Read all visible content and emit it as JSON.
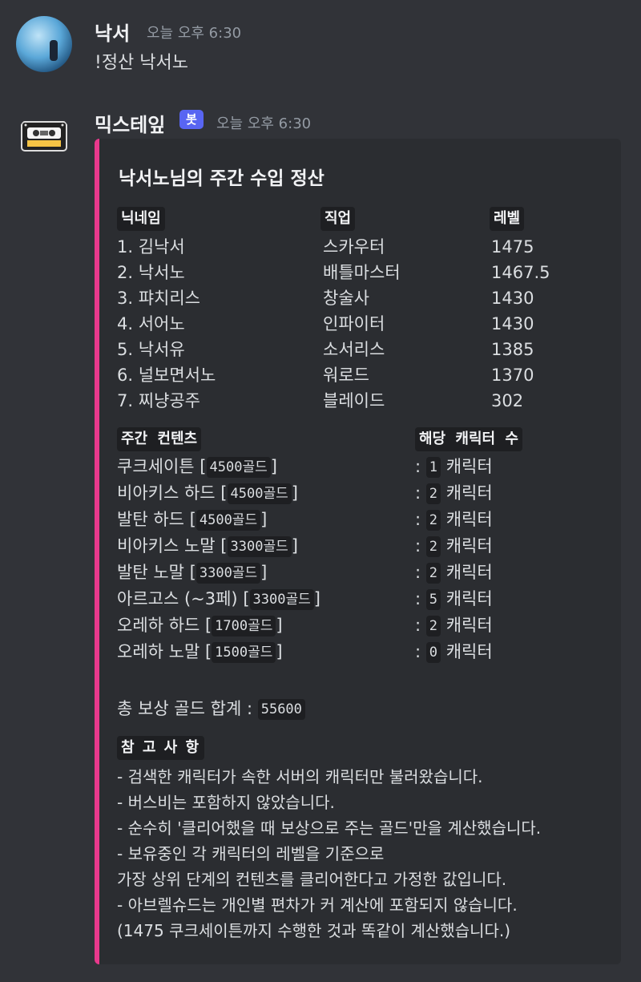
{
  "messages": [
    {
      "username": "낙서",
      "timestamp": "오늘 오후 6:30",
      "content": "!정산 낙서노"
    },
    {
      "username": "믹스테잎",
      "badge": "봇",
      "timestamp": "오늘 오후 6:30"
    }
  ],
  "embed": {
    "accent_color": "#e8398c",
    "title": "낙서노님의 주간 수입 정산",
    "characters_headers": {
      "nickname": "닉네임",
      "job": "직업",
      "level": "레벨"
    },
    "characters": [
      {
        "name": "1. 김낙서",
        "job": "스카우터",
        "level": "1475"
      },
      {
        "name": "2. 낙서노",
        "job": "배틀마스터",
        "level": "1467.5"
      },
      {
        "name": "3. 퍄치리스",
        "job": "창술사",
        "level": "1430"
      },
      {
        "name": "4. 서어노",
        "job": "인파이터",
        "level": "1430"
      },
      {
        "name": "5. 낙서유",
        "job": "소서리스",
        "level": "1385"
      },
      {
        "name": "6. 널보면서노",
        "job": "워로드",
        "level": "1370"
      },
      {
        "name": "7. 찌냥공주",
        "job": "블레이드",
        "level": "302"
      }
    ],
    "content_headers": {
      "content": "주간 컨텐츠",
      "count": "해당 캐릭터 수"
    },
    "contents": [
      {
        "name": "쿠크세이튼",
        "gold": "4500골드",
        "count": "1",
        "unit": "캐릭터"
      },
      {
        "name": "비아키스 하드",
        "gold": "4500골드",
        "count": "2",
        "unit": "캐릭터"
      },
      {
        "name": "발탄 하드",
        "gold": "4500골드",
        "count": "2",
        "unit": "캐릭터"
      },
      {
        "name": "비아키스 노말",
        "gold": "3300골드",
        "count": "2",
        "unit": "캐릭터"
      },
      {
        "name": "발탄 노말",
        "gold": "3300골드",
        "count": "2",
        "unit": "캐릭터"
      },
      {
        "name": "아르고스 (~3페)",
        "gold": "3300골드",
        "count": "5",
        "unit": "캐릭터"
      },
      {
        "name": "오레하 하드",
        "gold": "1700골드",
        "count": "2",
        "unit": "캐릭터"
      },
      {
        "name": "오레하 노말",
        "gold": "1500골드",
        "count": "0",
        "unit": "캐릭터"
      }
    ],
    "total_label": "총 보상 골드 합계 :",
    "total_value": "55600",
    "notes_header": "참 고 사 항",
    "notes": [
      "- 검색한 캐릭터가 속한 서버의 캐릭터만 불러왔습니다.",
      "- 버스비는 포함하지 않았습니다.",
      "- 순수히 '클리어했을 때 보상으로 주는 골드'만을 계산했습니다.",
      "- 보유중인 각 캐릭터의 레벨을 기준으로",
      "가장 상위 단계의 컨텐츠를 클리어한다고 가정한 값입니다.",
      "- 아브렐슈드는 개인별 편차가 커 계산에 포함되지 않습니다.",
      "(1475 쿠크세이튼까지 수행한 것과 똑같이 계산했습니다.)"
    ]
  }
}
